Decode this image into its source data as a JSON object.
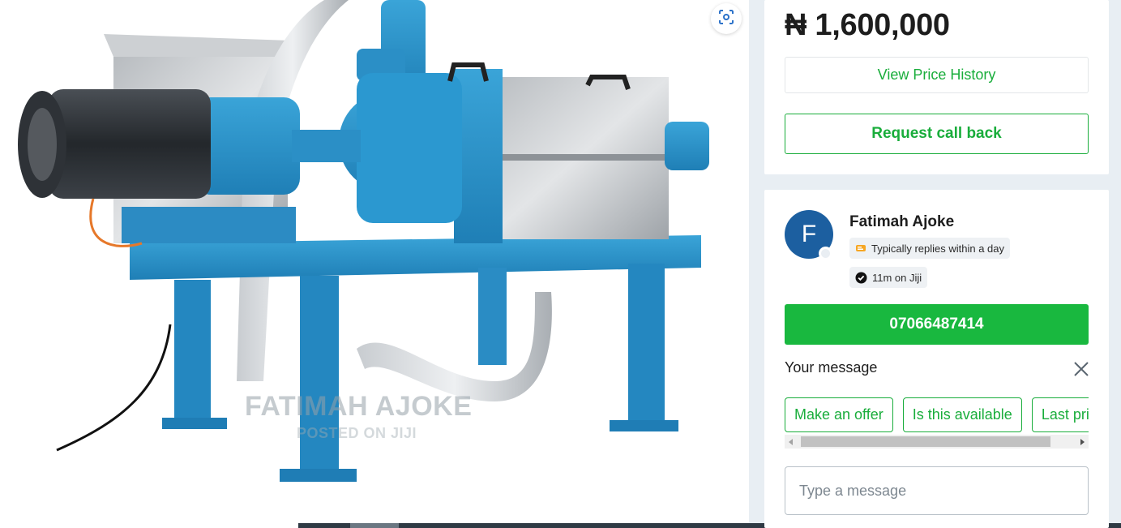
{
  "listing": {
    "price": "₦ 1,600,000",
    "view_price_history": "View Price History",
    "request_call_back": "Request call back"
  },
  "image": {
    "watermark_name": "FATIMAH AJOKE",
    "watermark_sub": "POSTED ON JIJI"
  },
  "seller": {
    "avatar_initial": "F",
    "name": "Fatimah Ajoke",
    "reply_badge": "Typically replies within a day",
    "tenure_badge": "11m on Jiji",
    "phone": "07066487414"
  },
  "message": {
    "label": "Your message",
    "quick_replies": [
      "Make an offer",
      "Is this available",
      "Last price"
    ],
    "input_placeholder": "Type a message"
  },
  "colors": {
    "accent_green": "#19ad3b",
    "phone_button": "#19b83f",
    "avatar_blue": "#1c5fa0"
  },
  "icons": [
    "lens-icon",
    "clock-icon",
    "verified-check-icon",
    "close-icon",
    "scroll-left-arrow-icon",
    "scroll-right-arrow-icon"
  ]
}
